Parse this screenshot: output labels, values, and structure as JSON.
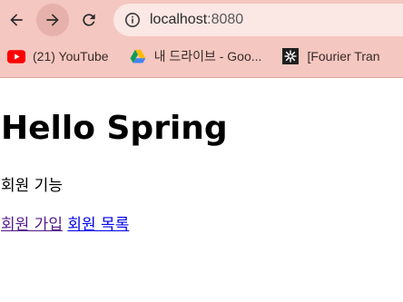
{
  "browser": {
    "url_host": "localhost",
    "url_port": ":8080",
    "bookmarks": [
      {
        "label": "(21) YouTube",
        "icon": "youtube-icon"
      },
      {
        "label": "내 드라이브 - Goo...",
        "icon": "google-drive-icon"
      },
      {
        "label": "[Fourier Tran",
        "icon": "fourier-site-icon"
      }
    ]
  },
  "page": {
    "title": "Hello Spring",
    "subtitle": "회원 기능",
    "links": [
      {
        "label": "회원 가입"
      },
      {
        "label": "회원 목록"
      }
    ]
  }
}
